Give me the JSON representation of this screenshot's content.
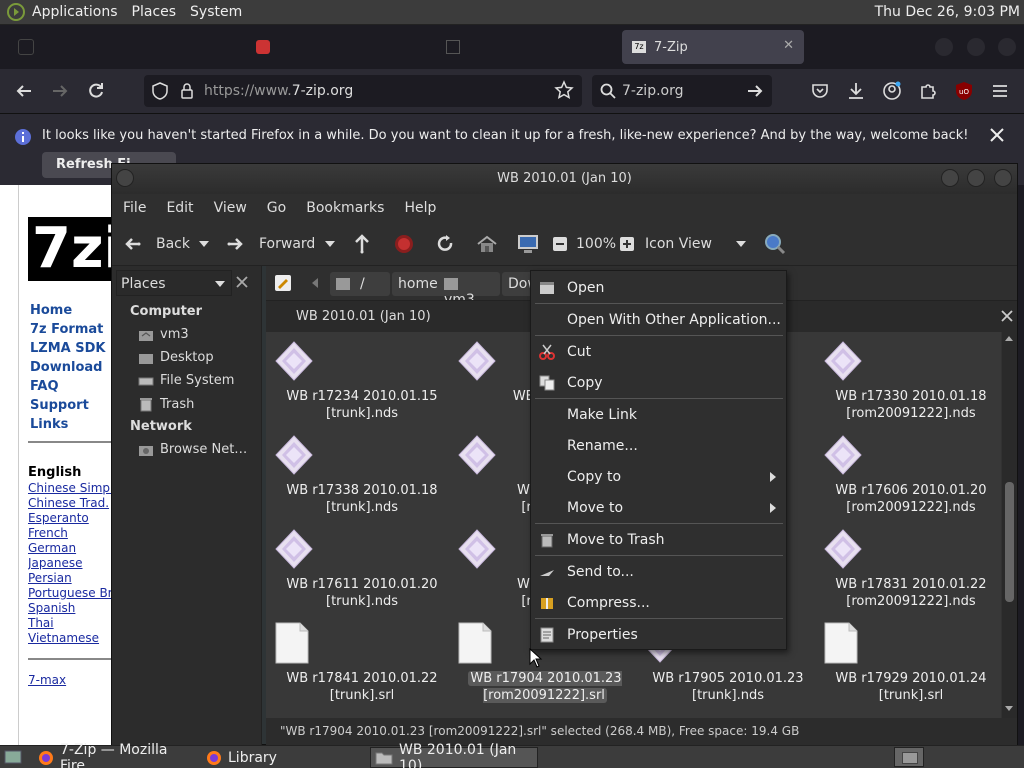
{
  "top_panel": {
    "menus": [
      "Applications",
      "Places",
      "System"
    ],
    "clock": "Thu Dec 26,  9:03 PM"
  },
  "firefox": {
    "active_tab": "7-Zip",
    "url_prefix": "https://www.",
    "url_domain": "7-zip.org",
    "search_text": "7-zip.org",
    "notification": "It looks like you haven't started Firefox in a while. Do you want to clean it up for a fresh, like-new experience? And by the way, welcome back!",
    "refresh_button": "Refresh Fi"
  },
  "webpage": {
    "logo_text": "7zi",
    "nav": [
      "Home",
      "7z Format",
      "LZMA SDK",
      "Download",
      "FAQ",
      "Support",
      "Links"
    ],
    "lang_heading": "English",
    "languages": [
      "Chinese Simpl.",
      "Chinese Trad.",
      "Esperanto",
      "French",
      "German",
      "Japanese",
      "Persian",
      "Portuguese Br.",
      "Spanish",
      "Thai",
      "Vietnamese"
    ],
    "footer_link": "7-max"
  },
  "file_manager": {
    "title": "WB 2010.01 (Jan 10)",
    "menus": [
      "File",
      "Edit",
      "View",
      "Go",
      "Bookmarks",
      "Help"
    ],
    "toolbar": {
      "back": "Back",
      "forward": "Forward",
      "zoom": "100%",
      "view_mode": "Icon View"
    },
    "sidebar": {
      "selector": "Places",
      "computer_heading": "Computer",
      "computer_items": [
        "vm3",
        "Desktop",
        "File System",
        "Trash"
      ],
      "network_heading": "Network",
      "network_items": [
        "Browse Net…"
      ]
    },
    "breadcrumbs": [
      "/",
      "home",
      "vm3",
      "Downlo"
    ],
    "pane_title": "WB 2010.01 (Jan 10)",
    "files": [
      {
        "name": "WB r17234 2010.01.15 [trunk].nds",
        "type": "nds"
      },
      {
        "name": "WB r1725",
        "type": "nds",
        "extra": "[tr"
      },
      {
        "name": "7",
        "type": "nds"
      },
      {
        "name": "WB r17330 2010.01.18 [rom20091222].nds",
        "type": "nds"
      },
      {
        "name": "WB r17338 2010.01.18 [trunk].nds",
        "type": "nds"
      },
      {
        "name": "WB r174",
        "type": "nds",
        "extra": "[rom20"
      },
      {
        "name": "9",
        "type": "nds"
      },
      {
        "name": "WB r17606 2010.01.20 [rom20091222].nds",
        "type": "nds"
      },
      {
        "name": "WB r17611 2010.01.20 [trunk].nds",
        "type": "nds"
      },
      {
        "name": "WB r177",
        "type": "nds",
        "extra": "[rom20"
      },
      {
        "name": "1",
        "type": "nds"
      },
      {
        "name": "WB r17831 2010.01.22 [rom20091222].nds",
        "type": "nds"
      },
      {
        "name": "WB r17841 2010.01.22 [trunk].srl",
        "type": "srl"
      },
      {
        "name": "WB r17904 2010.01.23 [rom20091222].srl",
        "type": "srl"
      },
      {
        "name": "WB r17905 2010.01.23 [trunk].nds",
        "type": "nds"
      },
      {
        "name": "WB r17929 2010.01.24 [trunk].srl",
        "type": "srl"
      }
    ],
    "status": "\"WB r17904 2010.01.23 [rom20091222].srl\" selected (268.4 MB), Free space: 19.4 GB"
  },
  "context_menu": {
    "items": [
      "Open",
      "Open With Other Application...",
      "Cut",
      "Copy",
      "Make Link",
      "Rename...",
      "Copy to",
      "Move to",
      "Move to Trash",
      "Send to...",
      "Compress...",
      "Properties"
    ]
  },
  "taskbar": {
    "items": [
      "7-Zip — Mozilla Fire…",
      "Library",
      "WB 2010.01 (Jan 10)"
    ]
  }
}
